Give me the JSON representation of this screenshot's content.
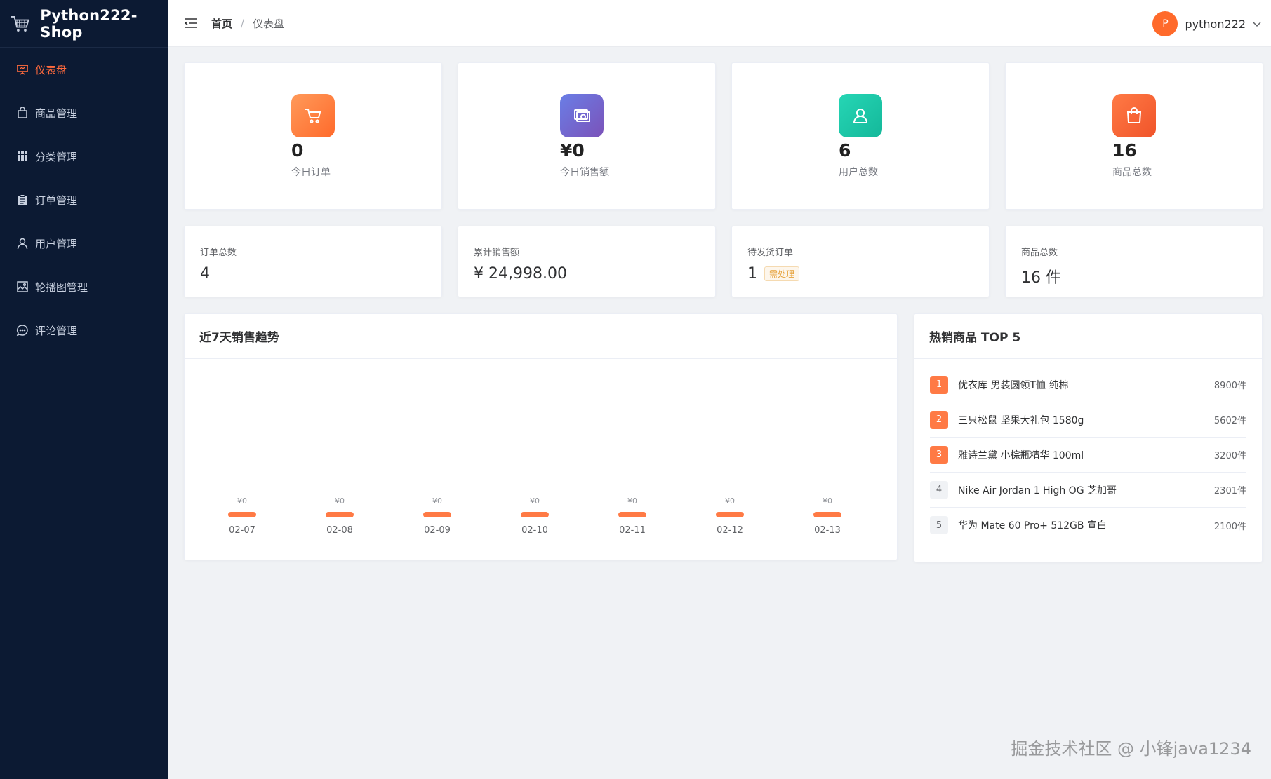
{
  "app": {
    "title": "Python222-Shop"
  },
  "sidebar": {
    "items": [
      {
        "label": "仪表盘",
        "icon": "presentation-icon",
        "active": true
      },
      {
        "label": "商品管理",
        "icon": "shopping-bag-icon",
        "active": false
      },
      {
        "label": "分类管理",
        "icon": "grid-icon",
        "active": false
      },
      {
        "label": "订单管理",
        "icon": "clipboard-icon",
        "active": false
      },
      {
        "label": "用户管理",
        "icon": "user-icon",
        "active": false
      },
      {
        "label": "轮播图管理",
        "icon": "picture-icon",
        "active": false
      },
      {
        "label": "评论管理",
        "icon": "chat-bubble-icon",
        "active": false
      }
    ]
  },
  "header": {
    "breadcrumb": {
      "home": "首页",
      "separator": "/",
      "current": "仪表盘"
    },
    "user": {
      "avatar_letter": "P",
      "name": "python222"
    }
  },
  "stats": [
    {
      "value": "0",
      "label": "今日订单",
      "icon": "cart-icon",
      "color_from": "#ff9a5a",
      "color_to": "#ff6a2b"
    },
    {
      "value": "¥0",
      "label": "今日销售额",
      "icon": "money-icon",
      "color_from": "#6a7ee6",
      "color_to": "#7b52b9"
    },
    {
      "value": "6",
      "label": "用户总数",
      "icon": "user-icon",
      "color_from": "#26d6b5",
      "color_to": "#14b89a"
    },
    {
      "value": "16",
      "label": "商品总数",
      "icon": "shopping-bag-icon",
      "color_from": "#ff7a45",
      "color_to": "#f0542a"
    }
  ],
  "summary": [
    {
      "label": "订单总数",
      "value": "4",
      "badge": ""
    },
    {
      "label": "累计销售额",
      "value": "¥ 24,998.00",
      "badge": ""
    },
    {
      "label": "待发货订单",
      "value": "1",
      "badge": "需处理"
    },
    {
      "label": "商品总数",
      "value": "16 件",
      "badge": ""
    }
  ],
  "chart_panel": {
    "title": "近7天销售趋势"
  },
  "chart_data": {
    "type": "bar",
    "categories": [
      "02-07",
      "02-08",
      "02-09",
      "02-10",
      "02-11",
      "02-12",
      "02-13"
    ],
    "values": [
      0,
      0,
      0,
      0,
      0,
      0,
      0
    ],
    "value_labels": [
      "¥0",
      "¥0",
      "¥0",
      "¥0",
      "¥0",
      "¥0",
      "¥0"
    ],
    "title": "近7天销售趋势",
    "bar_color": "#ff7a45",
    "grid": false
  },
  "hot_panel": {
    "title": "热销商品 TOP 5",
    "items": [
      {
        "rank": "1",
        "name": "优衣库 男装圆领T恤 纯棉",
        "count": "8900件"
      },
      {
        "rank": "2",
        "name": "三只松鼠 坚果大礼包 1580g",
        "count": "5602件"
      },
      {
        "rank": "3",
        "name": "雅诗兰黛 小棕瓶精华 100ml",
        "count": "3200件"
      },
      {
        "rank": "4",
        "name": "Nike Air Jordan 1 High OG 芝加哥",
        "count": "2301件"
      },
      {
        "rank": "5",
        "name": "华为 Mate 60 Pro+ 512GB 宣白",
        "count": "2100件"
      }
    ]
  },
  "watermark": "掘金技术社区 @ 小锋java1234"
}
